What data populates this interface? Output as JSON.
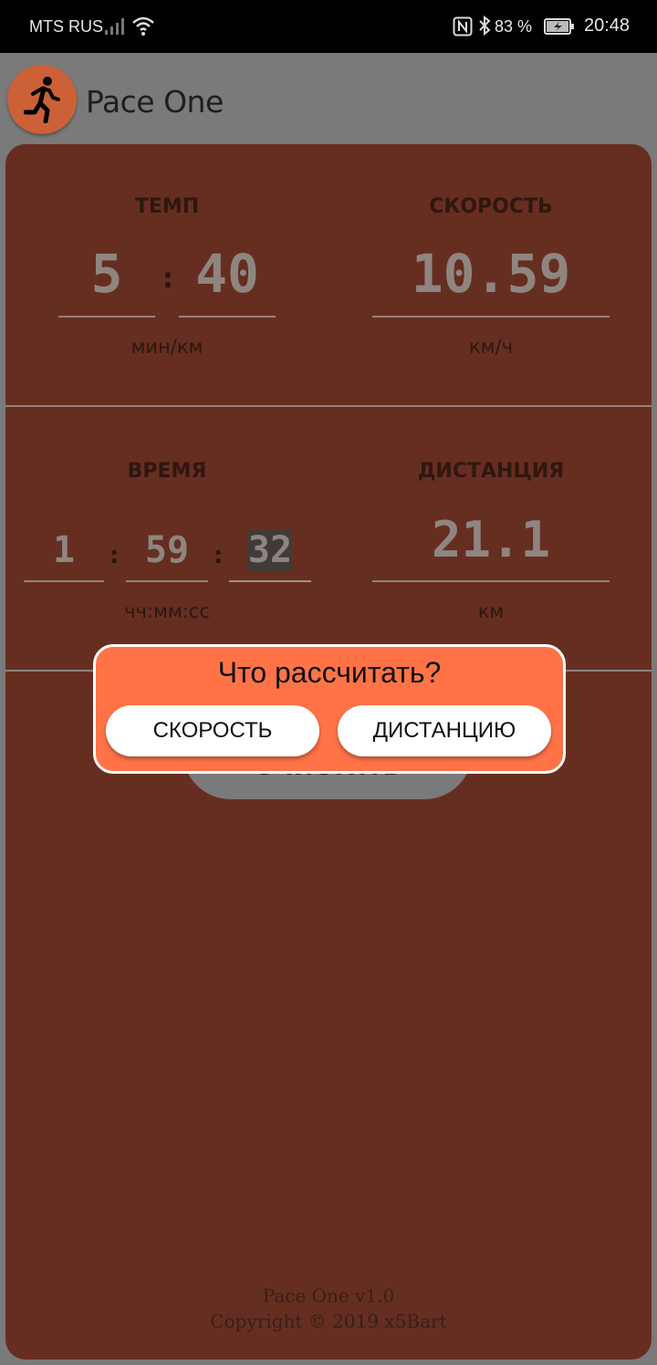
{
  "status_bar": {
    "carrier": "MTS RUS",
    "battery": "83 %",
    "time": "20:48"
  },
  "app": {
    "title": "Pace One",
    "logo_icon": "running-man-icon"
  },
  "pace": {
    "label": "ТЕМП",
    "minutes": "5",
    "seconds": "40",
    "separator": ":",
    "unit": "мин/км"
  },
  "speed": {
    "label": "СКОРОСТЬ",
    "value": "10.59",
    "unit": "км/ч"
  },
  "time": {
    "label": "ВРЕМЯ",
    "hours": "1",
    "minutes": "59",
    "seconds": "32",
    "separator": ":",
    "unit": "чч:мм:сс"
  },
  "distance": {
    "label": "ДИСТАНЦИЯ",
    "value": "21.1",
    "unit": "км"
  },
  "clear_button": {
    "label": "ОЧИСТИТЬ"
  },
  "footer": {
    "version": "Pace One v1.0",
    "copyright": "Copyright © 2019 x5Bart"
  },
  "dialog": {
    "title": "Что рассчитать?",
    "option_speed": "СКОРОСТЬ",
    "option_distance": "ДИСТАНЦИЮ"
  },
  "colors": {
    "card": "#662e20",
    "overlay": "#7a7a7a",
    "dialog": "#ff7346",
    "accent": "#cc6138"
  }
}
